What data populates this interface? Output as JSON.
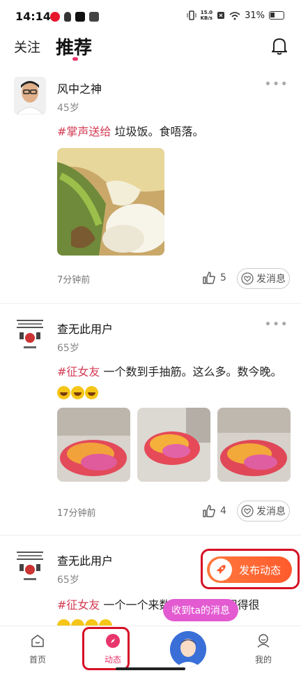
{
  "status_bar": {
    "time": "14:14",
    "net_speed_value": "15.0",
    "net_speed_unit": "KB/s",
    "battery": "31%"
  },
  "header": {
    "tab_follow": "关注",
    "tab_recommend": "推荐"
  },
  "posts": [
    {
      "username": "风中之神",
      "age": "45岁",
      "tag": "#掌声送给",
      "text": " 垃圾饭。食唔落。",
      "time": "7分钟前",
      "likes": "5",
      "message_label": "发消息"
    },
    {
      "username": "查无此用户",
      "age": "65岁",
      "tag": "#征女友",
      "text": " 一个数到手抽筋。这么多。数今晚。",
      "time": "17分钟前",
      "likes": "4",
      "message_label": "发消息"
    },
    {
      "username": "查无此用户",
      "age": "65岁",
      "tag": "#征女友",
      "text": " 一个一个来数…手抽筋。困得很"
    }
  ],
  "publish_label": "发布动态",
  "tooltip": "收到ta的消息",
  "nav": {
    "home": "首页",
    "dynamic": "动态",
    "mine": "我的"
  },
  "colors": {
    "accent": "#e8366b",
    "tag": "#d33a52",
    "publish": "#ff6a34",
    "tooltip": "#e35ad1",
    "highlight_box": "#d60f25"
  }
}
